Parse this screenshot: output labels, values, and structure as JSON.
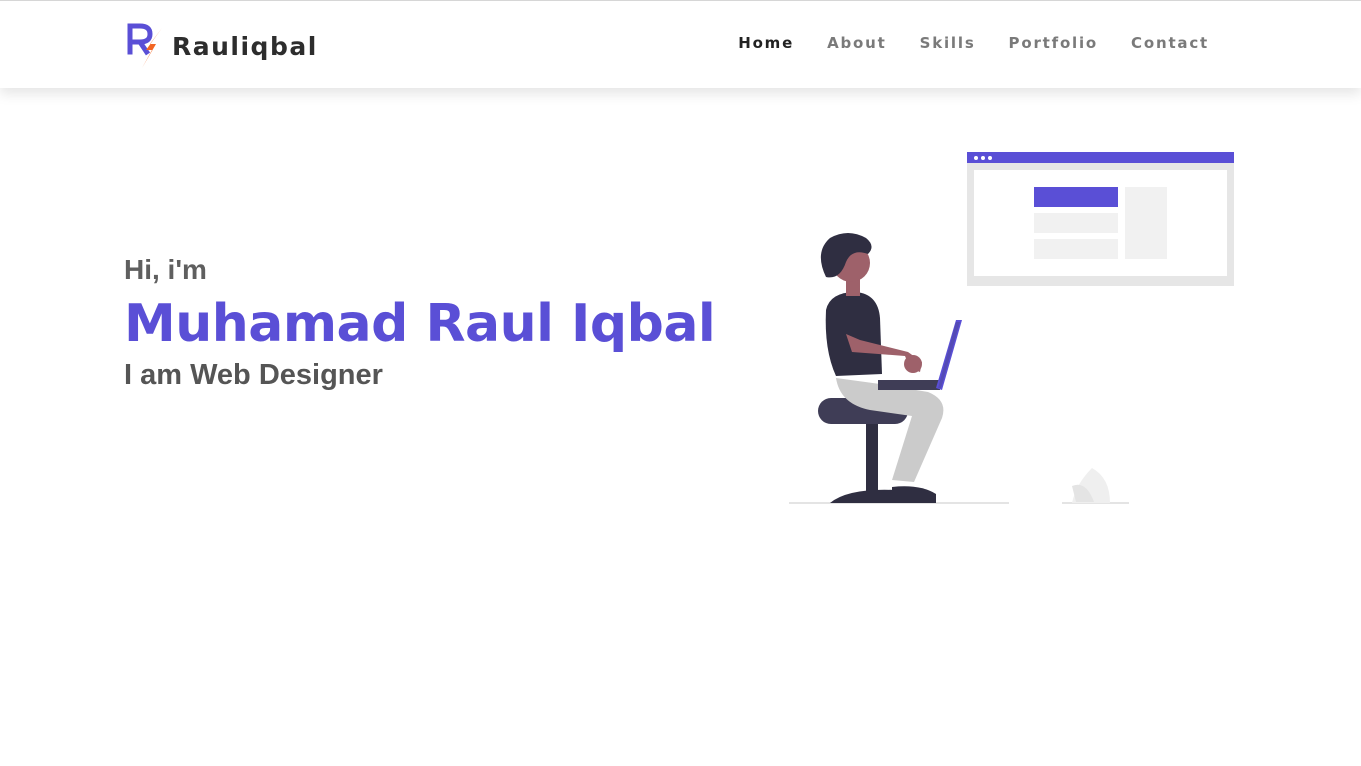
{
  "brand": {
    "logo_mark": "R",
    "name": "Rauliqbal"
  },
  "nav": {
    "items": [
      {
        "label": "Home",
        "active": true
      },
      {
        "label": "About",
        "active": false
      },
      {
        "label": "Skills",
        "active": false
      },
      {
        "label": "Portfolio",
        "active": false
      },
      {
        "label": "Contact",
        "active": false
      }
    ]
  },
  "hero": {
    "greeting": "Hi, i'm",
    "name": "Muhamad Raul Iqbal",
    "role": "I am Web Designer"
  },
  "colors": {
    "accent": "#5a4fd6",
    "logo_accent": "#f26522",
    "text_dark": "#2d2d2d",
    "text_muted": "#7a7a7a"
  },
  "illustration": {
    "icon": "person-with-laptop-illustration"
  }
}
